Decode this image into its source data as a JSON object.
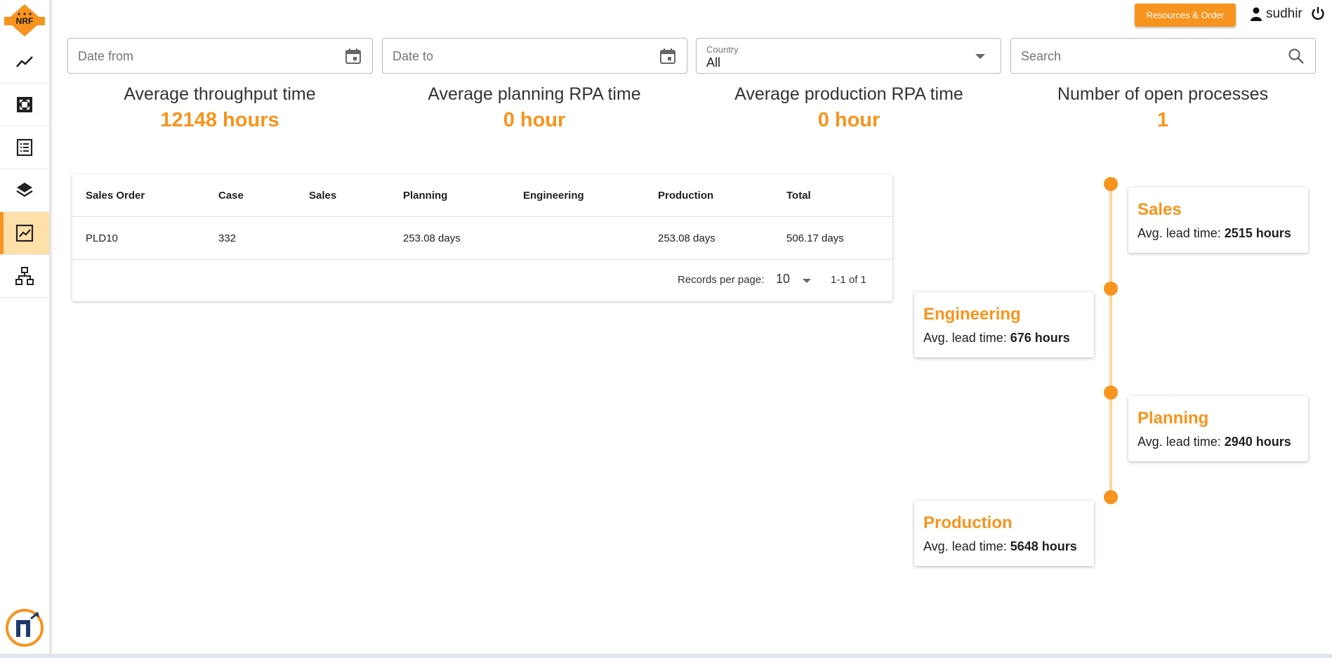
{
  "header": {
    "resources_label": "Resources & Order",
    "username": "sudhir"
  },
  "sidebar": {
    "logo_text": "NRF",
    "items": [
      {
        "icon": "trend-line-icon"
      },
      {
        "icon": "expand-arrows-icon"
      },
      {
        "icon": "list-document-icon"
      },
      {
        "icon": "layers-icon"
      },
      {
        "icon": "analytics-chart-icon",
        "active": true
      },
      {
        "icon": "sitemap-icon"
      }
    ]
  },
  "filters": {
    "date_from_placeholder": "Date from",
    "date_to_placeholder": "Date to",
    "country_label": "Country",
    "country_value": "All",
    "search_placeholder": "Search"
  },
  "kpis": [
    {
      "label": "Average throughput time",
      "value": "12148 hours"
    },
    {
      "label": "Average planning RPA time",
      "value": "0 hour"
    },
    {
      "label": "Average production RPA time",
      "value": "0 hour"
    },
    {
      "label": "Number of open processes",
      "value": "1"
    }
  ],
  "table": {
    "columns": [
      "Sales Order",
      "Case",
      "Sales",
      "Planning",
      "Engineering",
      "Production",
      "Total"
    ],
    "rows": [
      [
        "PLD10",
        "332",
        "",
        "253.08 days",
        "",
        "253.08 days",
        "506.17 days"
      ]
    ],
    "records_per_page_label": "Records per page:",
    "records_per_page": "10",
    "range": "1-1 of 1"
  },
  "timeline": {
    "lead_prefix": "Avg. lead time:",
    "stages": [
      {
        "name": "Sales",
        "lead": "2515 hours"
      },
      {
        "name": "Engineering",
        "lead": "676 hours"
      },
      {
        "name": "Planning",
        "lead": "2940 hours"
      },
      {
        "name": "Production",
        "lead": "5648 hours"
      }
    ]
  },
  "colors": {
    "accent": "#f7941d",
    "active_nav_bg": "#ffe0a8",
    "timeline_line": "#fcd89a"
  }
}
